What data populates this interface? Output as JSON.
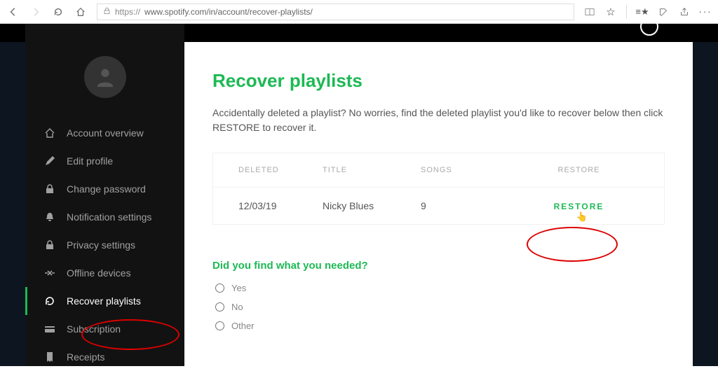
{
  "browser": {
    "url_proto": "https://",
    "url_rest": "www.spotify.com/in/account/recover-playlists/"
  },
  "sidebar": {
    "items": [
      {
        "label": "Account overview",
        "icon": "home-icon"
      },
      {
        "label": "Edit profile",
        "icon": "pencil-icon"
      },
      {
        "label": "Change password",
        "icon": "lock-icon"
      },
      {
        "label": "Notification settings",
        "icon": "bell-icon"
      },
      {
        "label": "Privacy settings",
        "icon": "lock-icon"
      },
      {
        "label": "Offline devices",
        "icon": "offline-icon"
      },
      {
        "label": "Recover playlists",
        "icon": "recover-icon"
      },
      {
        "label": "Subscription",
        "icon": "card-icon"
      },
      {
        "label": "Receipts",
        "icon": "receipt-icon"
      }
    ],
    "active_index": 6
  },
  "main": {
    "title": "Recover playlists",
    "description": "Accidentally deleted a playlist? No worries, find the deleted playlist you'd like to recover below then click RESTORE to recover it.",
    "columns": {
      "deleted": "DELETED",
      "title": "TITLE",
      "songs": "SONGS",
      "restore": "RESTORE"
    },
    "rows": [
      {
        "deleted": "12/03/19",
        "title": "Nicky Blues",
        "songs": "9",
        "restore": "RESTORE"
      }
    ],
    "feedback": {
      "question": "Did you find what you needed?",
      "options": [
        "Yes",
        "No",
        "Other"
      ]
    }
  }
}
